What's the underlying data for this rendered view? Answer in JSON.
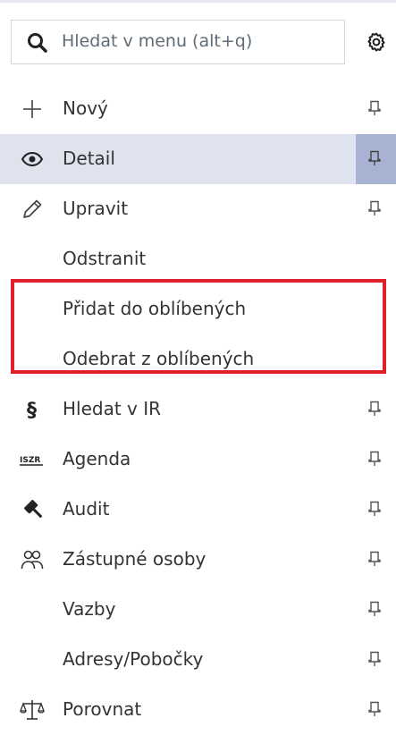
{
  "search": {
    "placeholder": "Hledat v menu (alt+q)"
  },
  "menu": {
    "items": [
      {
        "label": "Nový",
        "icon": "plus-icon",
        "pinned": true
      },
      {
        "label": "Detail",
        "icon": "eye-icon",
        "pinned": true,
        "active": true
      },
      {
        "label": "Upravit",
        "icon": "pencil-icon",
        "pinned": true
      },
      {
        "label": "Odstranit",
        "icon": "",
        "pinned": false
      },
      {
        "label": "Přidat do oblíbených",
        "icon": "",
        "pinned": false
      },
      {
        "label": "Odebrat z oblíbených",
        "icon": "",
        "pinned": false
      },
      {
        "label": "Hledat v IR",
        "icon": "paragraph-icon",
        "pinned": true
      },
      {
        "label": "Agenda",
        "icon": "iszr-icon",
        "pinned": true
      },
      {
        "label": "Audit",
        "icon": "gavel-icon",
        "pinned": true
      },
      {
        "label": "Zástupné osoby",
        "icon": "people-icon",
        "pinned": true
      },
      {
        "label": "Vazby",
        "icon": "",
        "pinned": true
      },
      {
        "label": "Adresy/Pobočky",
        "icon": "",
        "pinned": true
      },
      {
        "label": "Porovnat",
        "icon": "scales-icon",
        "pinned": true
      }
    ]
  },
  "icons": {
    "iszr_text": "ISZR"
  },
  "colors": {
    "active_row": "#dfe3ee",
    "active_pin": "#a8b2d3",
    "highlight_border": "#e0212b"
  }
}
